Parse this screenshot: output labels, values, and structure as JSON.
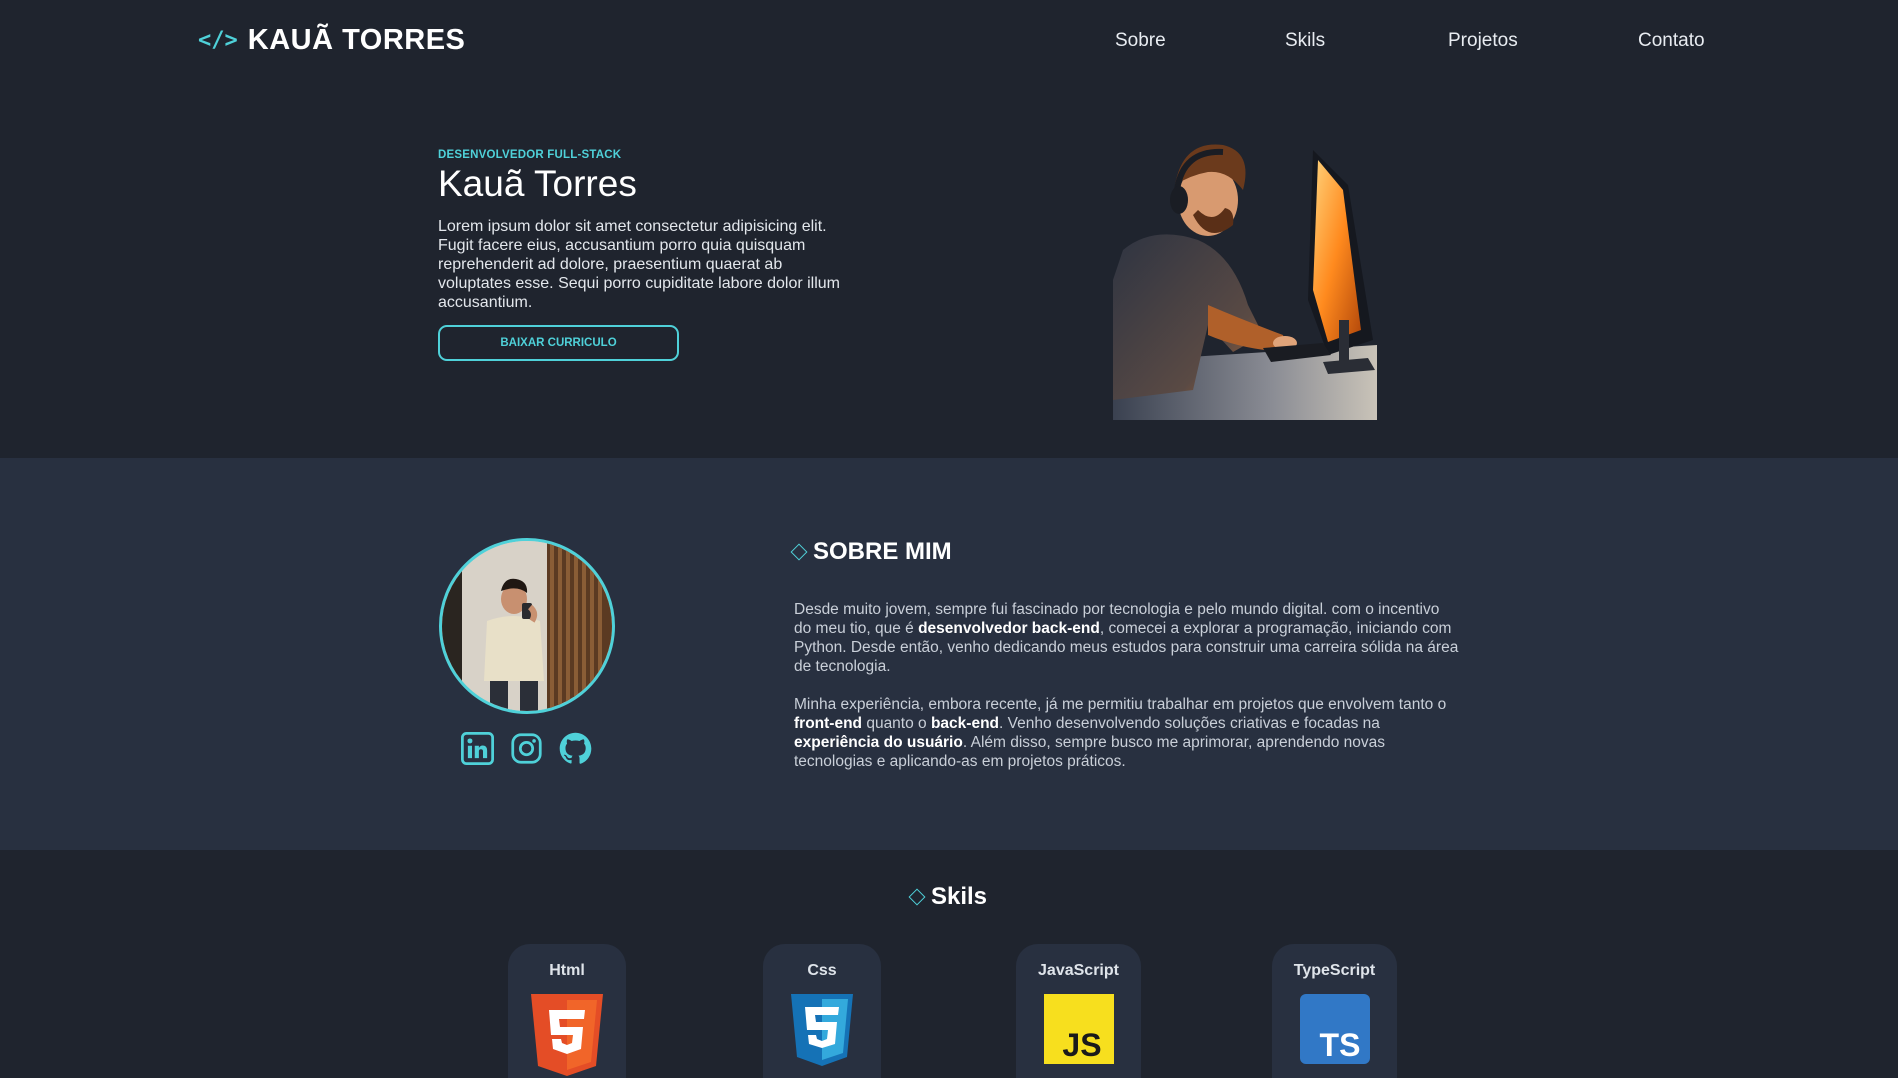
{
  "header": {
    "logo_icon": "code-icon",
    "logo_text": "KAUÃ TORRES",
    "nav": [
      "Sobre",
      "Skils",
      "Projetos",
      "Contato"
    ]
  },
  "hero": {
    "eyebrow": "DESENVOLVEDOR FULL-STACK",
    "name": "Kauã Torres",
    "description": "Lorem ipsum dolor sit amet consectetur adipisicing elit. Fugit facere eius, accusantium porro quia quisquam reprehenderit ad dolore, praesentium quaerat ab voluptates esse. Sequi porro cupiditate labore dolor illum accusantium.",
    "cv_button": "BAIXAR CURRICULO"
  },
  "about": {
    "title": "SOBRE MIM",
    "p1": {
      "a": "Desde muito jovem, sempre fui fascinado por tecnologia e pelo mundo digital. com o incentivo do meu tio, que é ",
      "b": "desenvolvedor back-end",
      "c": ", comecei a explorar a programação, iniciando com Python. Desde então, venho dedicando meus estudos para construir uma carreira sólida na área de tecnologia."
    },
    "p2": {
      "a": "Minha experiência, embora recente, já me permitiu trabalhar em projetos que envolvem tanto o ",
      "b": "front-end",
      "c": " quanto o ",
      "d": "back-end",
      "e": ". Venho desenvolvendo soluções criativas e focadas na ",
      "f": "experiência do usuário",
      "g": ". Além disso, sempre busco me aprimorar, aprendendo novas tecnologias e aplicando-as em projetos práticos."
    },
    "socials": [
      "linkedin-icon",
      "instagram-icon",
      "github-icon"
    ]
  },
  "skills": {
    "title": "Skils",
    "items": [
      {
        "name": "Html",
        "icon": "html5-icon",
        "color": "#e44d26"
      },
      {
        "name": "Css",
        "icon": "css3-icon",
        "color": "#2965f1"
      },
      {
        "name": "JavaScript",
        "icon": "js-icon",
        "color": "#f7df1e"
      },
      {
        "name": "TypeScript",
        "icon": "ts-icon",
        "color": "#3178c6"
      }
    ]
  },
  "colors": {
    "accent": "#4fd1d9",
    "bg_dark": "#1f242e",
    "bg_section": "#283040"
  }
}
